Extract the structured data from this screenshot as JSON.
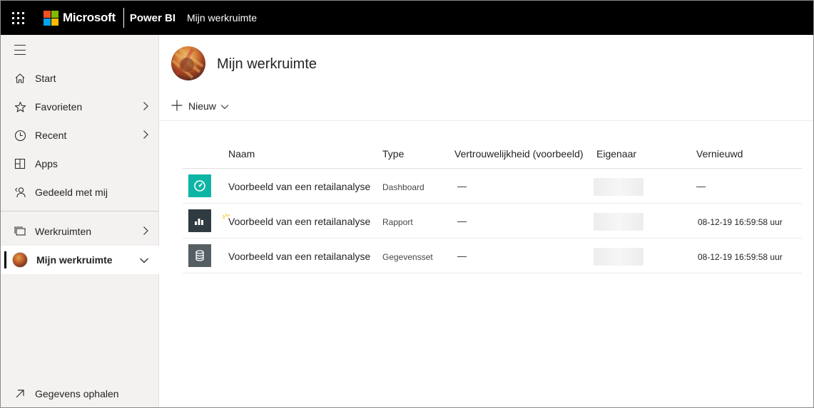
{
  "topbar": {
    "brand": "Microsoft",
    "product": "Power BI",
    "breadcrumb": "Mijn werkruimte",
    "app_launcher_icon": "waffle-icon",
    "brand_colors": [
      "#f25022",
      "#7fba00",
      "#00a4ef",
      "#ffb900"
    ]
  },
  "sidebar": {
    "collapse_icon": "hamburger-icon",
    "items": [
      {
        "label": "Start",
        "icon": "home-icon"
      },
      {
        "label": "Favorieten",
        "icon": "star-icon",
        "chevron": true
      },
      {
        "label": "Recent",
        "icon": "clock-icon",
        "chevron": true
      },
      {
        "label": "Apps",
        "icon": "apps-icon"
      },
      {
        "label": "Gedeeld met mij",
        "icon": "shared-person-icon"
      }
    ],
    "workspaces": {
      "label": "Werkruimten",
      "icon": "workspaces-icon"
    },
    "my_workspace": {
      "label": "Mijn werkruimte",
      "expanded": true
    },
    "get_data": {
      "label": "Gegevens ophalen",
      "icon": "arrow-up-right-icon"
    }
  },
  "main": {
    "workspace_title": "Mijn werkruimte",
    "new_button": "Nieuw",
    "columns": [
      "Naam",
      "Type",
      "Vertrouwelijkheid (voorbeeld)",
      "Eigenaar",
      "Vernieuwd"
    ],
    "rows": [
      {
        "name": "Voorbeeld van een retailanalyse",
        "type": "Dashboard",
        "sensitivity": "—",
        "refreshed": "—",
        "icon": "dashboard-icon",
        "icon_color": "#0db5a5",
        "is_new": false
      },
      {
        "name": "Voorbeeld van een retailanalyse",
        "type": "Rapport",
        "sensitivity": "—",
        "refreshed": "08-12-19 16:59:58 uur",
        "icon": "report-icon",
        "icon_color": "#2f3b40",
        "is_new": true
      },
      {
        "name": "Voorbeeld van een retailanalyse",
        "type": "Gegevensset",
        "sensitivity": "—",
        "refreshed": "08-12-19 16:59:58 uur",
        "icon": "dataset-icon",
        "icon_color": "#555f63",
        "is_new": false
      }
    ]
  }
}
